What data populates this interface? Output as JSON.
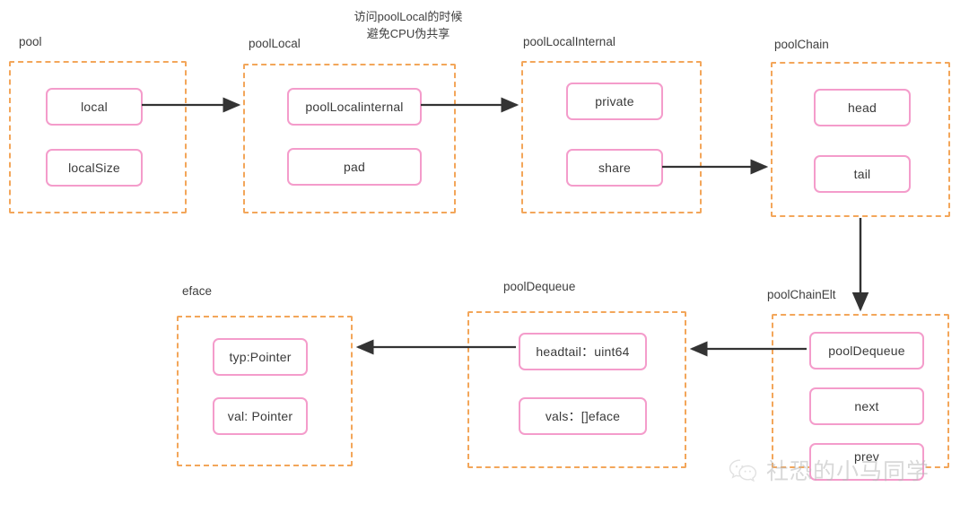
{
  "diagram": {
    "title": "Go sync.Pool structure diagram",
    "colors": {
      "group_border": "#f3a65a",
      "field_border": "#f49ccb",
      "connector": "#333333",
      "text": "#3a3a3a",
      "background": "#ffffff",
      "watermark": "#b9b9b9"
    },
    "note": {
      "line1": "访问poolLocal的时候",
      "line2": "避免CPU伪共享"
    },
    "groups": [
      {
        "id": "pool",
        "label": "pool",
        "fields": [
          {
            "label": "local"
          },
          {
            "label": "localSize"
          }
        ]
      },
      {
        "id": "poolLocal",
        "label": "poolLocal",
        "fields": [
          {
            "label": "poolLocalinternal"
          },
          {
            "label": "pad"
          }
        ]
      },
      {
        "id": "poolLocalInternal",
        "label": "poolLocalInternal",
        "fields": [
          {
            "label": "private"
          },
          {
            "label": "share"
          }
        ]
      },
      {
        "id": "poolChain",
        "label": "poolChain",
        "fields": [
          {
            "label": "head"
          },
          {
            "label": "tail"
          }
        ]
      },
      {
        "id": "eface",
        "label": "eface",
        "fields": [
          {
            "label": "typ:Pointer"
          },
          {
            "label": "val: Pointer"
          }
        ]
      },
      {
        "id": "poolDequeue",
        "label": "poolDequeue",
        "fields": [
          {
            "label": "headtail：uint64"
          },
          {
            "label": "vals：[]eface"
          }
        ]
      },
      {
        "id": "poolChainElt",
        "label": "poolChainElt",
        "fields": [
          {
            "label": "poolDequeue"
          },
          {
            "label": "next"
          },
          {
            "label": "prev"
          }
        ]
      }
    ],
    "connectors": [
      {
        "id": "local-to-poolLocal",
        "from": "pool.local",
        "to": "poolLocal",
        "direction": "right"
      },
      {
        "id": "poolLocalinternal-to-poolLocalInternal",
        "from": "poolLocal.poolLocalinternal",
        "to": "poolLocalInternal",
        "direction": "right"
      },
      {
        "id": "share-to-poolChain",
        "from": "poolLocalInternal.share",
        "to": "poolChain",
        "direction": "right"
      },
      {
        "id": "poolChain-to-poolChainElt",
        "from": "poolChain",
        "to": "poolChainElt",
        "direction": "down"
      },
      {
        "id": "poolChainElt-to-poolDequeue",
        "from": "poolChainElt.poolDequeue",
        "to": "poolDequeue",
        "direction": "left"
      },
      {
        "id": "headtail-to-eface",
        "from": "poolDequeue.headtail",
        "to": "eface",
        "direction": "left"
      }
    ]
  },
  "watermark": {
    "icon": "wechat-icon",
    "text": "社恐的小马同学"
  }
}
